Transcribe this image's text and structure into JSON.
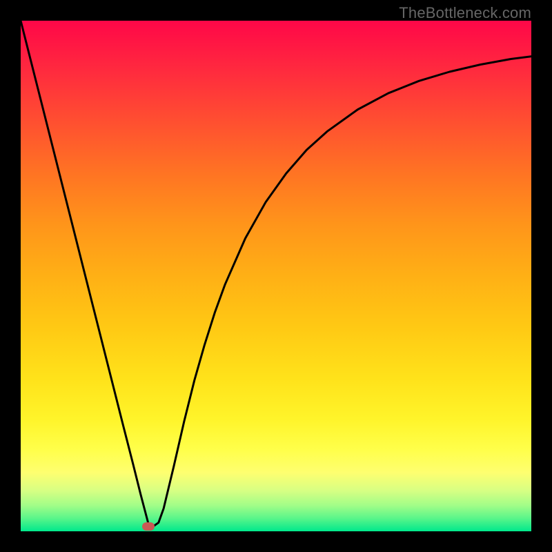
{
  "watermark": "TheBottleneck.com",
  "colors": {
    "marker": "#c95955",
    "curve": "#000000",
    "frame": "#000000"
  },
  "gradient_stops": [
    {
      "offset": 0.0,
      "color": "#ff0748"
    },
    {
      "offset": 0.1,
      "color": "#ff2b3e"
    },
    {
      "offset": 0.2,
      "color": "#ff5030"
    },
    {
      "offset": 0.3,
      "color": "#ff7423"
    },
    {
      "offset": 0.4,
      "color": "#ff951a"
    },
    {
      "offset": 0.5,
      "color": "#ffb015"
    },
    {
      "offset": 0.6,
      "color": "#ffc914"
    },
    {
      "offset": 0.7,
      "color": "#ffe21a"
    },
    {
      "offset": 0.78,
      "color": "#fff42a"
    },
    {
      "offset": 0.84,
      "color": "#ffff4a"
    },
    {
      "offset": 0.885,
      "color": "#feff70"
    },
    {
      "offset": 0.92,
      "color": "#d8ff83"
    },
    {
      "offset": 0.95,
      "color": "#a0fd88"
    },
    {
      "offset": 0.975,
      "color": "#58f58a"
    },
    {
      "offset": 1.0,
      "color": "#00e88c"
    }
  ],
  "chart_data": {
    "type": "line",
    "title": "",
    "xlabel": "",
    "ylabel": "",
    "xlim": [
      0,
      100
    ],
    "ylim": [
      0,
      100
    ],
    "x": [
      0,
      2,
      4,
      6,
      8,
      10,
      12,
      14,
      16,
      18,
      20,
      22,
      23.5,
      25,
      26,
      27,
      28,
      30,
      32,
      34,
      36,
      38,
      40,
      44,
      48,
      52,
      56,
      60,
      66,
      72,
      78,
      84,
      90,
      96,
      100
    ],
    "y": [
      100,
      92.1,
      84.2,
      76.3,
      68.4,
      60.5,
      52.6,
      44.7,
      36.8,
      28.9,
      21.0,
      13.2,
      7.2,
      1.5,
      1.0,
      1.7,
      4.5,
      12.8,
      21.5,
      29.5,
      36.5,
      42.8,
      48.3,
      57.4,
      64.5,
      70.1,
      74.7,
      78.3,
      82.6,
      85.8,
      88.2,
      90.0,
      91.4,
      92.5,
      93.0
    ],
    "marker": {
      "x": 25.0,
      "y": 1.0
    }
  }
}
